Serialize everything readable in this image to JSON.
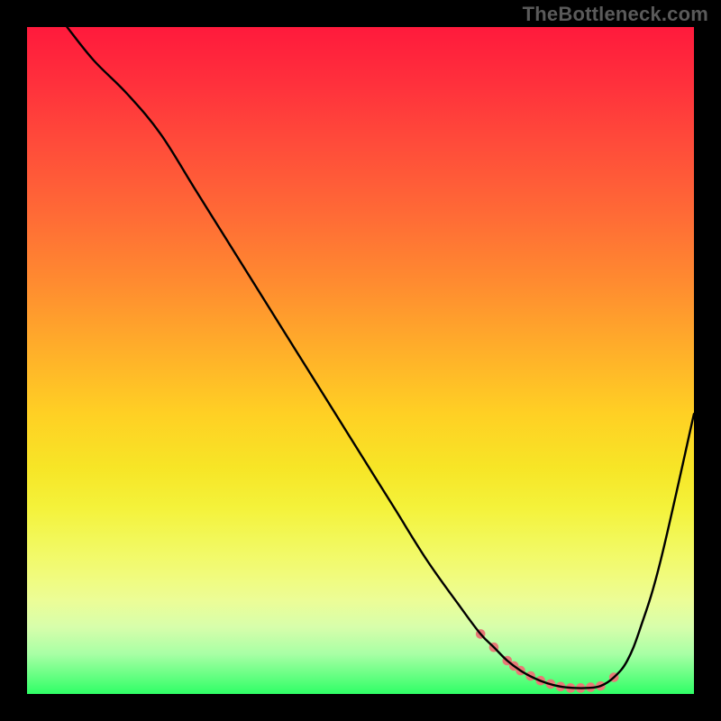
{
  "watermark": "TheBottleneck.com",
  "chart_data": {
    "type": "line",
    "title": "",
    "xlabel": "",
    "ylabel": "",
    "xlim": [
      0,
      100
    ],
    "ylim": [
      0,
      100
    ],
    "grid": false,
    "series": [
      {
        "name": "curve",
        "color": "#000000",
        "x": [
          6,
          10,
          15,
          20,
          25,
          30,
          35,
          40,
          45,
          50,
          55,
          60,
          65,
          68,
          70,
          72,
          74,
          76,
          78,
          80,
          82,
          84,
          86,
          88,
          90,
          92,
          95,
          100
        ],
        "y": [
          100,
          95,
          90,
          84,
          76,
          68,
          60,
          52,
          44,
          36,
          28,
          20,
          13,
          9,
          7,
          5,
          3.5,
          2.4,
          1.6,
          1.1,
          0.9,
          0.9,
          1.2,
          2.5,
          5,
          10,
          20,
          42
        ]
      }
    ],
    "markers": {
      "name": "highlight-points",
      "color": "#e77a77",
      "radius": 5.3,
      "points": [
        {
          "x": 68.0,
          "y": 9.0
        },
        {
          "x": 70.0,
          "y": 7.0
        },
        {
          "x": 72.0,
          "y": 5.0
        },
        {
          "x": 73.0,
          "y": 4.2
        },
        {
          "x": 74.0,
          "y": 3.5
        },
        {
          "x": 75.5,
          "y": 2.7
        },
        {
          "x": 77.0,
          "y": 2.0
        },
        {
          "x": 78.5,
          "y": 1.5
        },
        {
          "x": 80.0,
          "y": 1.1
        },
        {
          "x": 81.5,
          "y": 0.9
        },
        {
          "x": 83.0,
          "y": 0.9
        },
        {
          "x": 84.5,
          "y": 1.0
        },
        {
          "x": 86.0,
          "y": 1.2
        },
        {
          "x": 88.0,
          "y": 2.5
        }
      ]
    }
  }
}
